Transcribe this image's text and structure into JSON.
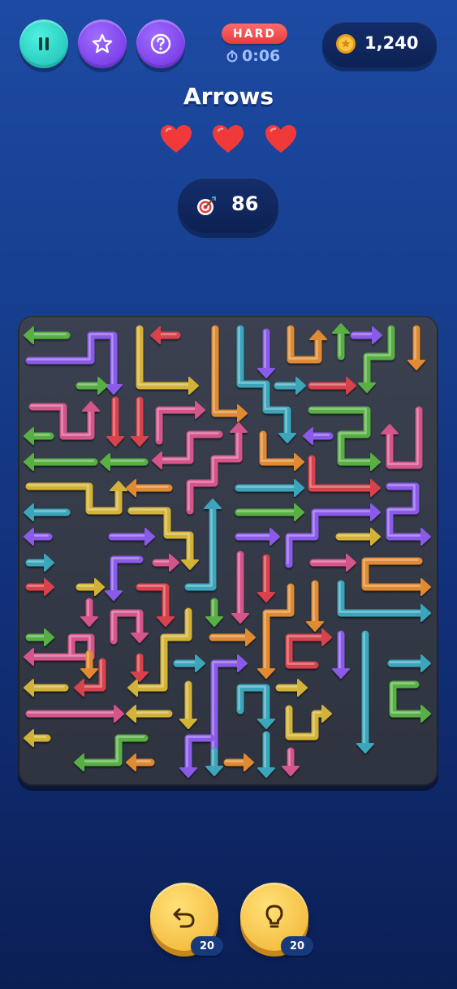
{
  "hud": {
    "difficulty": "HARD",
    "timer": "0:06",
    "coins": "1,240",
    "moves": "86"
  },
  "level": {
    "title": "Arrows",
    "lives": 3
  },
  "actions": {
    "undo_count": "20",
    "hint_count": "20"
  },
  "icons": {
    "pause": "pause-icon",
    "favorite": "star-icon",
    "help": "question-icon",
    "timer": "stopwatch-icon",
    "coin": "coin-icon",
    "heart": "heart-icon",
    "moves": "target-icon",
    "undo": "undo-icon",
    "hint": "lightbulb-icon"
  },
  "palette": {
    "teal": "#2ccbc0",
    "purple": "#7a3df0",
    "hard_red": "#ee4747",
    "gold": "#f5bd3b",
    "heart": "#f03a3a",
    "arrow_green": "#58b044",
    "arrow_purple": "#8a5ae8",
    "arrow_gold": "#d3b237",
    "arrow_red": "#d8434d",
    "arrow_orange": "#e08a31",
    "arrow_teal": "#3aa6bb",
    "arrow_pink": "#d4548a"
  }
}
